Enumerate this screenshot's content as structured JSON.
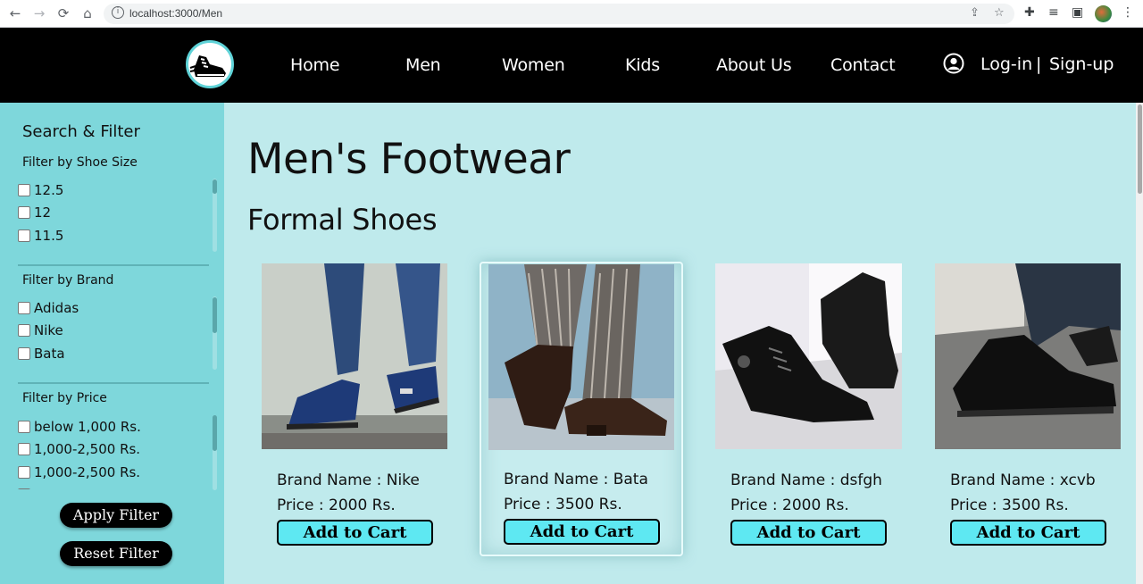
{
  "browser": {
    "url": "localhost:3000/Men",
    "back_icon": "←",
    "forward_icon": "→",
    "reload_icon": "⟳",
    "home_icon": "⌂"
  },
  "header": {
    "nav": [
      "Home",
      "Men",
      "Women",
      "Kids",
      "About Us",
      "Contact"
    ],
    "login": "Log-in",
    "separator": "|",
    "signup": "Sign-up"
  },
  "sidebar": {
    "title": "Search & Filter",
    "size_filter": {
      "title": "Filter by Shoe Size",
      "options": [
        "12.5",
        "12",
        "11.5"
      ]
    },
    "brand_filter": {
      "title": "Filter by Brand",
      "options": [
        "Adidas",
        "Nike",
        "Bata"
      ]
    },
    "price_filter": {
      "title": "Filter by Price",
      "options": [
        "below 1,000 Rs.",
        "1,000-2,500 Rs.",
        "1,000-2,500 Rs."
      ]
    },
    "apply_label": "Apply Filter",
    "reset_label": "Reset Filter"
  },
  "main": {
    "page_title": "Men's Footwear",
    "section_title": "Formal Shoes",
    "products": [
      {
        "brand": "Brand Name : Nike",
        "price": "Price : 2000 Rs.",
        "cart_label": "Add to Cart"
      },
      {
        "brand": "Brand Name : Bata",
        "price": "Price : 3500 Rs.",
        "cart_label": "Add to Cart"
      },
      {
        "brand": "Brand Name : dsfgh",
        "price": "Price : 2000 Rs.",
        "cart_label": "Add to Cart"
      },
      {
        "brand": "Brand Name : xcvb",
        "price": "Price : 3500 Rs.",
        "cart_label": "Add to Cart"
      }
    ]
  },
  "colors": {
    "header_bg": "#000000",
    "sidebar_bg": "#7ed7db",
    "main_bg": "#bfeaec",
    "cart_button": "#5ee8f2"
  }
}
